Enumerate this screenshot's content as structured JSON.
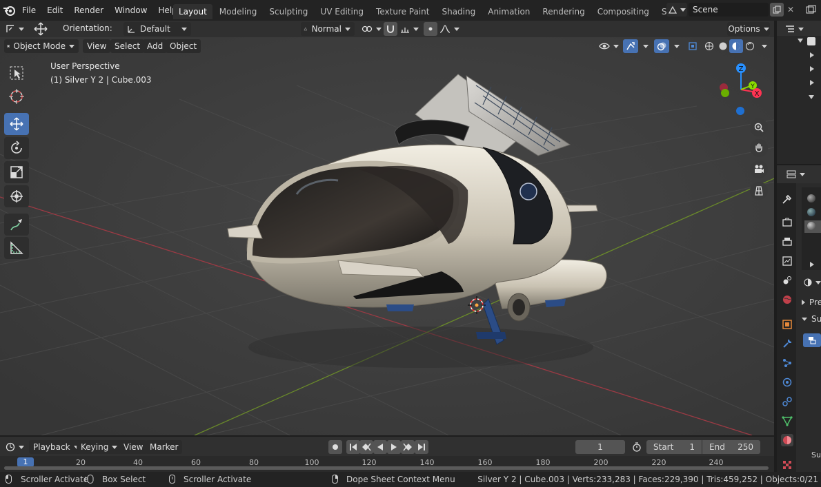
{
  "topbar": {
    "menus": [
      "File",
      "Edit",
      "Render",
      "Window",
      "Help"
    ],
    "workspaces": [
      "Layout",
      "Modeling",
      "Sculpting",
      "UV Editing",
      "Texture Paint",
      "Shading",
      "Animation",
      "Rendering",
      "Compositing",
      "Scripting"
    ],
    "active_workspace": "Layout",
    "scene_name": "Scene"
  },
  "tool_header": {
    "orientation_label": "Orientation:",
    "orientation_value": "Default",
    "pivot_value": "Normal",
    "options_label": "Options"
  },
  "viewport_header": {
    "mode": "Object Mode",
    "menus": [
      "View",
      "Select",
      "Add",
      "Object"
    ]
  },
  "viewport": {
    "perspective_label": "User Perspective",
    "object_label": "(1) Silver Y 2 | Cube.003",
    "gizmo_axes": [
      "Z",
      "Y",
      "X"
    ]
  },
  "timeline": {
    "menus": [
      "Playback",
      "Keying",
      "View",
      "Marker"
    ],
    "current_frame": "1",
    "start_label": "Start",
    "start_value": "1",
    "end_label": "End",
    "end_value": "250",
    "ticks": [
      "1",
      "20",
      "40",
      "60",
      "80",
      "100",
      "120",
      "140",
      "160",
      "180",
      "200",
      "220",
      "240"
    ]
  },
  "properties": {
    "section_pre": "Pre",
    "section_sub": "Su",
    "item_sub": "Sub"
  },
  "statusbar": {
    "items": [
      "Scroller Activate",
      "Box Select",
      "Scroller Activate",
      "Dope Sheet Context Menu"
    ],
    "stats": "Silver Y 2 | Cube.003 | Verts:233,283 | Faces:229,390 | Tris:459,252 | Objects:0/21"
  },
  "colors": {
    "accent": "#4772b3",
    "axis_x": "#ff3352",
    "axis_y": "#8bdc00",
    "axis_z": "#2890ff"
  }
}
